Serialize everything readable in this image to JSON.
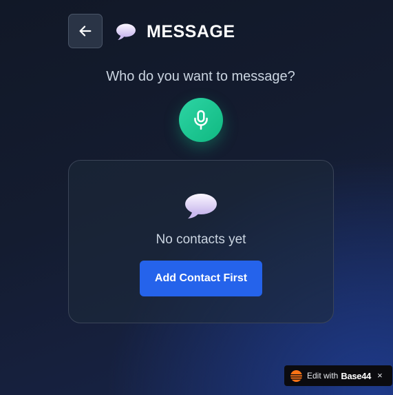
{
  "header": {
    "back_icon": "arrow-left-icon",
    "title_icon": "speech-balloon-icon",
    "title": "MESSAGE"
  },
  "prompt": "Who do you want to message?",
  "mic": {
    "icon": "microphone-icon",
    "color": "#10b981"
  },
  "contacts_card": {
    "empty_icon": "speech-balloon-icon",
    "empty_text": "No contacts yet",
    "button_label": "Add Contact First",
    "button_color": "#2563eb"
  },
  "badge": {
    "label": "Edit with",
    "brand": "Base44",
    "close_symbol": "×",
    "logo_color": "#f97316"
  }
}
